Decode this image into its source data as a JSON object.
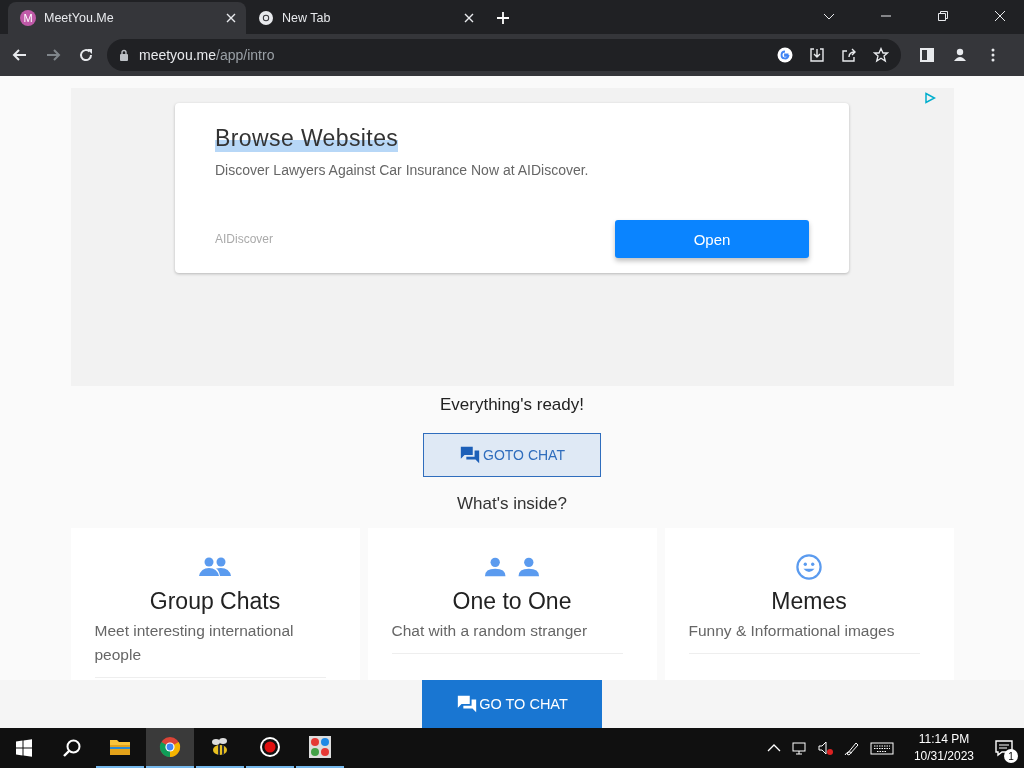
{
  "browser": {
    "tabs": [
      {
        "title": "MeetYou.Me",
        "kind": "letter",
        "icon_text": "M",
        "selected": true
      },
      {
        "title": "New Tab",
        "kind": "chrome",
        "selected": false
      }
    ],
    "url": {
      "domain": "meetyou.me",
      "path": "/app/intro"
    }
  },
  "ad": {
    "title": "Browse Websites",
    "text": "Discover Lawyers Against Car Insurance Now at AIDiscover.",
    "advertiser": "AIDiscover",
    "button": "Open"
  },
  "status": "Everything's ready!",
  "goto_button": "GOTO CHAT",
  "section_title": "What's inside?",
  "features": [
    {
      "kind": "group",
      "title": "Group Chats",
      "lines": [
        "Meet interesting international people"
      ]
    },
    {
      "kind": "pair",
      "title": "One to One",
      "lines": [
        "Chat with a random stranger"
      ]
    },
    {
      "kind": "smile",
      "title": "Memes",
      "lines": [
        "Funny & Informational images"
      ]
    }
  ],
  "footer_button": "GO TO CHAT",
  "taskbar": {
    "apps": [
      {
        "kind": "folder",
        "selected": false
      },
      {
        "kind": "chrome",
        "selected": true
      },
      {
        "kind": "bee",
        "selected": false
      },
      {
        "kind": "record",
        "selected": false
      },
      {
        "kind": "grid",
        "selected": false
      }
    ],
    "time": "11:14 PM",
    "date": "10/31/2023",
    "notifications": "1"
  }
}
